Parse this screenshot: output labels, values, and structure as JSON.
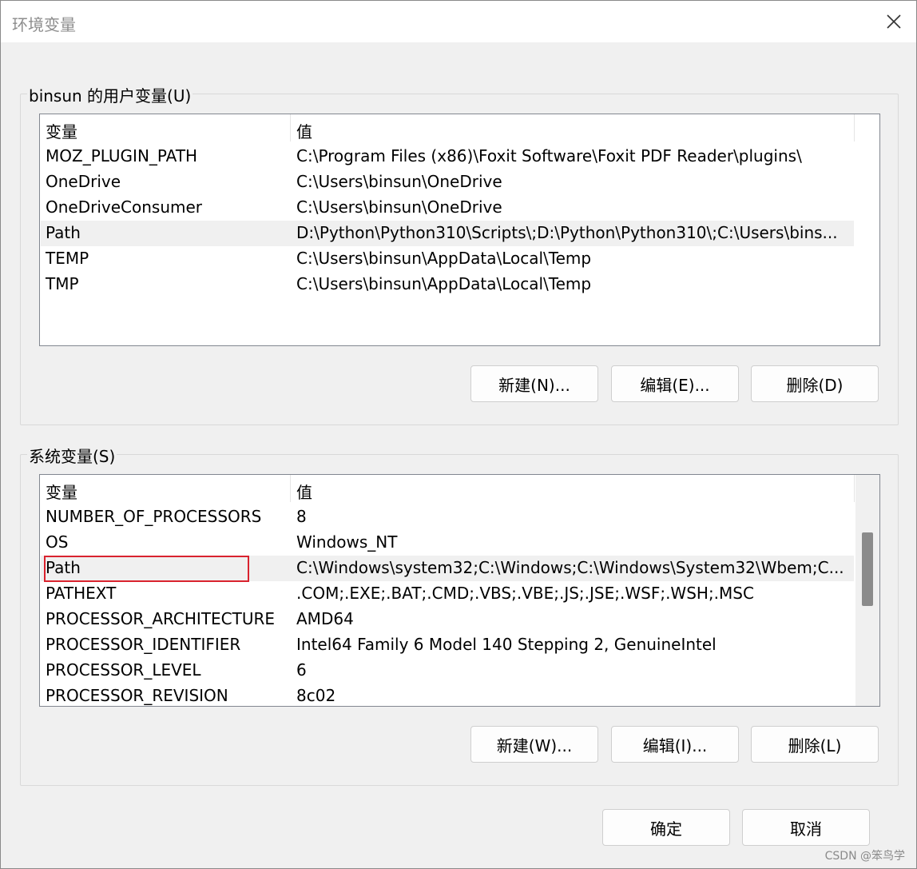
{
  "window": {
    "title": "环境变量"
  },
  "icons": {
    "close": "close-icon"
  },
  "user_section": {
    "label": "binsun 的用户变量(U)",
    "columns": [
      "变量",
      "值"
    ],
    "rows": [
      {
        "name": "MOZ_PLUGIN_PATH",
        "value": "C:\\Program Files (x86)\\Foxit Software\\Foxit PDF Reader\\plugins\\"
      },
      {
        "name": "OneDrive",
        "value": "C:\\Users\\binsun\\OneDrive"
      },
      {
        "name": "OneDriveConsumer",
        "value": "C:\\Users\\binsun\\OneDrive"
      },
      {
        "name": "Path",
        "value": "D:\\Python\\Python310\\Scripts\\;D:\\Python\\Python310\\;C:\\Users\\bins..."
      },
      {
        "name": "TEMP",
        "value": "C:\\Users\\binsun\\AppData\\Local\\Temp"
      },
      {
        "name": "TMP",
        "value": "C:\\Users\\binsun\\AppData\\Local\\Temp"
      }
    ],
    "selected_row": 3,
    "buttons": {
      "new": "新建(N)...",
      "edit": "编辑(E)...",
      "delete": "删除(D)"
    }
  },
  "system_section": {
    "label": "系统变量(S)",
    "columns": [
      "变量",
      "值"
    ],
    "rows": [
      {
        "name": "NUMBER_OF_PROCESSORS",
        "value": "8"
      },
      {
        "name": "OS",
        "value": "Windows_NT"
      },
      {
        "name": "Path",
        "value": "C:\\Windows\\system32;C:\\Windows;C:\\Windows\\System32\\Wbem;C..."
      },
      {
        "name": "PATHEXT",
        "value": ".COM;.EXE;.BAT;.CMD;.VBS;.VBE;.JS;.JSE;.WSF;.WSH;.MSC"
      },
      {
        "name": "PROCESSOR_ARCHITECTURE",
        "value": "AMD64"
      },
      {
        "name": "PROCESSOR_IDENTIFIER",
        "value": "Intel64 Family 6 Model 140 Stepping 2, GenuineIntel"
      },
      {
        "name": "PROCESSOR_LEVEL",
        "value": "6"
      },
      {
        "name": "PROCESSOR_REVISION",
        "value": "8c02"
      }
    ],
    "selected_row": 2,
    "buttons": {
      "new": "新建(W)...",
      "edit": "编辑(I)...",
      "delete": "删除(L)"
    }
  },
  "dialog_buttons": {
    "ok": "确定",
    "cancel": "取消"
  },
  "watermark": "CSDN @笨鸟学",
  "colors": {
    "highlight_border": "#d9232e",
    "selected_row": "#f0f0f0"
  }
}
